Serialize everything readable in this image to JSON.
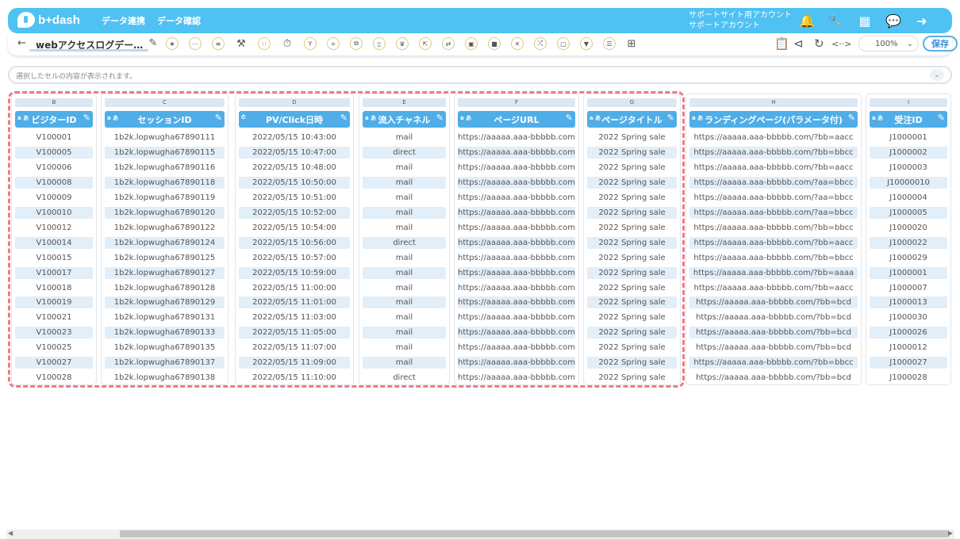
{
  "app": {
    "logo": "b+dash",
    "nav": [
      "データ連携",
      "データ確認"
    ],
    "account_line1": "サポートサイト用アカウント",
    "account_line2": "サポートアカウント"
  },
  "toolbar": {
    "back_icon": "arrow-left-icon",
    "title": "webアクセスログデー…",
    "zoom": "100%",
    "save_label": "保存"
  },
  "cellbar": {
    "placeholder": "選択したセルの内容が表示されます。"
  },
  "columns": [
    {
      "letter": "B",
      "type": "a あ",
      "name": "ビジターID",
      "cells": [
        "V100001",
        "V100005",
        "V100006",
        "V100008",
        "V100009",
        "V100010",
        "V100012",
        "V100014",
        "V100015",
        "V100017",
        "V100018",
        "V100019",
        "V100021",
        "V100023",
        "V100025",
        "V100027",
        "V100028"
      ]
    },
    {
      "letter": "C",
      "type": "a あ",
      "name": "セッションID",
      "cells": [
        "1b2k.lopwugha67890111",
        "1b2k.lopwugha67890115",
        "1b2k.lopwugha67890116",
        "1b2k.lopwugha67890118",
        "1b2k.lopwugha67890119",
        "1b2k.lopwugha67890120",
        "1b2k.lopwugha67890122",
        "1b2k.lopwugha67890124",
        "1b2k.lopwugha67890125",
        "1b2k.lopwugha67890127",
        "1b2k.lopwugha67890128",
        "1b2k.lopwugha67890129",
        "1b2k.lopwugha67890131",
        "1b2k.lopwugha67890133",
        "1b2k.lopwugha67890135",
        "1b2k.lopwugha67890137",
        "1b2k.lopwugha67890138"
      ]
    },
    {
      "letter": "D",
      "type": "⏱",
      "name": "PV/Click日時",
      "cells": [
        "2022/05/15 10:43:00",
        "2022/05/15 10:47:00",
        "2022/05/15 10:48:00",
        "2022/05/15 10:50:00",
        "2022/05/15 10:51:00",
        "2022/05/15 10:52:00",
        "2022/05/15 10:54:00",
        "2022/05/15 10:56:00",
        "2022/05/15 10:57:00",
        "2022/05/15 10:59:00",
        "2022/05/15 11:00:00",
        "2022/05/15 11:01:00",
        "2022/05/15 11:03:00",
        "2022/05/15 11:05:00",
        "2022/05/15 11:07:00",
        "2022/05/15 11:09:00",
        "2022/05/15 11:10:00"
      ]
    },
    {
      "letter": "E",
      "type": "a あ",
      "name": "流入チャネル",
      "cells": [
        "mail",
        "direct",
        "mail",
        "mail",
        "mail",
        "mail",
        "mail",
        "direct",
        "mail",
        "mail",
        "mail",
        "mail",
        "mail",
        "mail",
        "mail",
        "mail",
        "direct"
      ]
    },
    {
      "letter": "F",
      "type": "a あ",
      "name": "ページURL",
      "cells": [
        "https://aaaaa.aaa-bbbbb.com",
        "https://aaaaa.aaa-bbbbb.com",
        "https://aaaaa.aaa-bbbbb.com",
        "https://aaaaa.aaa-bbbbb.com",
        "https://aaaaa.aaa-bbbbb.com",
        "https://aaaaa.aaa-bbbbb.com",
        "https://aaaaa.aaa-bbbbb.com",
        "https://aaaaa.aaa-bbbbb.com",
        "https://aaaaa.aaa-bbbbb.com",
        "https://aaaaa.aaa-bbbbb.com",
        "https://aaaaa.aaa-bbbbb.com",
        "https://aaaaa.aaa-bbbbb.com",
        "https://aaaaa.aaa-bbbbb.com",
        "https://aaaaa.aaa-bbbbb.com",
        "https://aaaaa.aaa-bbbbb.com",
        "https://aaaaa.aaa-bbbbb.com",
        "https://aaaaa.aaa-bbbbb.com"
      ]
    },
    {
      "letter": "G",
      "type": "a あ",
      "name": "ページタイトル",
      "cells": [
        "2022 Spring sale",
        "2022 Spring sale",
        "2022 Spring sale",
        "2022 Spring sale",
        "2022 Spring sale",
        "2022 Spring sale",
        "2022 Spring sale",
        "2022 Spring sale",
        "2022 Spring sale",
        "2022 Spring sale",
        "2022 Spring sale",
        "2022 Spring sale",
        "2022 Spring sale",
        "2022 Spring sale",
        "2022 Spring sale",
        "2022 Spring sale",
        "2022 Spring sale"
      ]
    },
    {
      "letter": "H",
      "type": "a あ",
      "name": "ランディングページ(パラメータ付)",
      "cells": [
        "https://aaaaa.aaa-bbbbb.com/?bb=aacc",
        "https://aaaaa.aaa-bbbbb.com/?bb=bbcc",
        "https://aaaaa.aaa-bbbbb.com/?bb=aacc",
        "https://aaaaa.aaa-bbbbb.com/?aa=bbcc",
        "https://aaaaa.aaa-bbbbb.com/?aa=bbcc",
        "https://aaaaa.aaa-bbbbb.com/?aa=bbcc",
        "https://aaaaa.aaa-bbbbb.com/?bb=bbcc",
        "https://aaaaa.aaa-bbbbb.com/?bb=aacc",
        "https://aaaaa.aaa-bbbbb.com/?bb=bbcc",
        "https://aaaaa.aaa-bbbbb.com/?bb=aaaa",
        "https://aaaaa.aaa-bbbbb.com/?bb=aacc",
        "https://aaaaa.aaa-bbbbb.com/?bb=bcd",
        "https://aaaaa.aaa-bbbbb.com/?bb=bcd",
        "https://aaaaa.aaa-bbbbb.com/?bb=bcd",
        "https://aaaaa.aaa-bbbbb.com/?bb=bcd",
        "https://aaaaa.aaa-bbbbb.com/?bb=bbcc",
        "https://aaaaa.aaa-bbbbb.com/?bb=bcd"
      ]
    },
    {
      "letter": "I",
      "type": "a あ",
      "name": "受注ID",
      "cells": [
        "J1000001",
        "J1000002",
        "J1000003",
        "J10000010",
        "J1000004",
        "J1000005",
        "J1000020",
        "J1000022",
        "J1000029",
        "J1000001",
        "J1000007",
        "J1000013",
        "J1000030",
        "J1000026",
        "J1000012",
        "J1000027",
        "J1000028"
      ]
    }
  ]
}
